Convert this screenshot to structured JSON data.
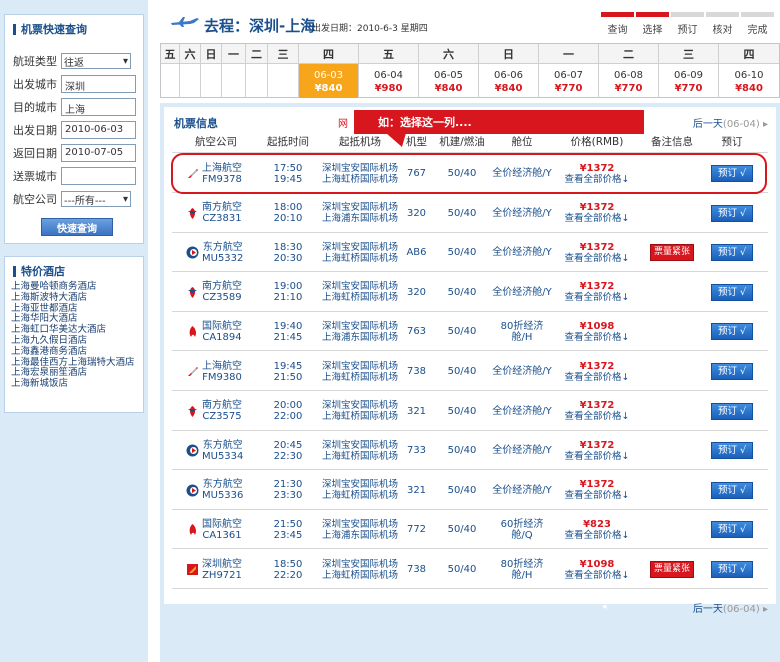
{
  "sidebar": {
    "search": {
      "title": "机票快速查询",
      "trip_type_label": "航班类型",
      "trip_type_value": "往返",
      "from_label": "出发城市",
      "from_value": "深圳",
      "to_label": "目的城市",
      "to_value": "上海",
      "depart_label": "出发日期",
      "depart_value": "2010-06-03",
      "return_label": "返回日期",
      "return_value": "2010-07-05",
      "delivery_label": "送票城市",
      "delivery_value": "",
      "airline_label": "航空公司",
      "airline_value": "---所有---",
      "submit_label": "快速查询"
    },
    "hotels": {
      "title": "特价酒店",
      "items": [
        "上海曼哈顿商务酒店",
        "上海斯波特大酒店",
        "上海亚世都酒店",
        "上海华阳大酒店",
        "上海虹口华美达大酒店",
        "上海九久假日酒店",
        "上海鑫港商务酒店",
        "上海最佳西方上海瑞特大酒店",
        "上海宏泉丽笙酒店",
        "上海新城饭店"
      ]
    }
  },
  "header": {
    "route": "去程：深圳-上海",
    "date_info": "出发日期：2010-6-3 星期四",
    "steps": [
      {
        "label": "查询",
        "active": true
      },
      {
        "label": "选择",
        "active": true
      },
      {
        "label": "预订",
        "active": false
      },
      {
        "label": "核对",
        "active": false
      },
      {
        "label": "完成",
        "active": false
      }
    ]
  },
  "calendar": {
    "weekdays": [
      "五",
      "六",
      "日",
      "一",
      "二",
      "三",
      "四",
      "五",
      "六",
      "日",
      "一",
      "二",
      "三",
      "四"
    ],
    "days": [
      {
        "date": "06-03",
        "price": "¥840",
        "selected": true
      },
      {
        "date": "06-04",
        "price": "¥980",
        "selected": false
      },
      {
        "date": "06-05",
        "price": "¥840",
        "selected": false
      },
      {
        "date": "06-06",
        "price": "¥840",
        "selected": false
      },
      {
        "date": "06-07",
        "price": "¥770",
        "selected": false
      },
      {
        "date": "06-08",
        "price": "¥770",
        "selected": false
      },
      {
        "date": "06-09",
        "price": "¥770",
        "selected": false
      },
      {
        "date": "06-10",
        "price": "¥840",
        "selected": false
      }
    ]
  },
  "panel": {
    "title": "机票信息",
    "callout_prefix": "网",
    "callout": "如：选择这一列....",
    "next_day_label": "后一天",
    "next_day_date": "(06-04)",
    "columns": [
      "航空公司",
      "起抵时间",
      "起抵机场",
      "机型",
      "机建/燃油",
      "舱位",
      "价格(RMB)",
      "备注信息",
      "预订"
    ]
  },
  "flights": [
    {
      "airline": "上海航空",
      "code": "FM9378",
      "dep": "17:50",
      "arr": "19:45",
      "from_airport": "深圳宝安国际机场",
      "to_airport": "上海虹桥国际机场",
      "model": "767",
      "tax": "50/40",
      "cabin": "全价经济舱/Y",
      "price": "¥1372",
      "note": "",
      "logo": "sha"
    },
    {
      "airline": "南方航空",
      "code": "CZ3831",
      "dep": "18:00",
      "arr": "20:10",
      "from_airport": "深圳宝安国际机场",
      "to_airport": "上海浦东国际机场",
      "model": "320",
      "tax": "50/40",
      "cabin": "全价经济舱/Y",
      "price": "¥1372",
      "note": "",
      "logo": "csn"
    },
    {
      "airline": "东方航空",
      "code": "MU5332",
      "dep": "18:30",
      "arr": "20:30",
      "from_airport": "深圳宝安国际机场",
      "to_airport": "上海虹桥国际机场",
      "model": "AB6",
      "tax": "50/40",
      "cabin": "全价经济舱/Y",
      "price": "¥1372",
      "note": "票量紧张",
      "logo": "ces"
    },
    {
      "airline": "南方航空",
      "code": "CZ3589",
      "dep": "19:00",
      "arr": "21:10",
      "from_airport": "深圳宝安国际机场",
      "to_airport": "上海虹桥国际机场",
      "model": "320",
      "tax": "50/40",
      "cabin": "全价经济舱/Y",
      "price": "¥1372",
      "note": "",
      "logo": "csn"
    },
    {
      "airline": "国际航空",
      "code": "CA1894",
      "dep": "19:40",
      "arr": "21:45",
      "from_airport": "深圳宝安国际机场",
      "to_airport": "上海浦东国际机场",
      "model": "763",
      "tax": "50/40",
      "cabin": "80折经济舱/H",
      "price": "¥1098",
      "note": "",
      "logo": "cca"
    },
    {
      "airline": "上海航空",
      "code": "FM9380",
      "dep": "19:45",
      "arr": "21:50",
      "from_airport": "深圳宝安国际机场",
      "to_airport": "上海虹桥国际机场",
      "model": "738",
      "tax": "50/40",
      "cabin": "全价经济舱/Y",
      "price": "¥1372",
      "note": "",
      "logo": "sha"
    },
    {
      "airline": "南方航空",
      "code": "CZ3575",
      "dep": "20:00",
      "arr": "22:00",
      "from_airport": "深圳宝安国际机场",
      "to_airport": "上海虹桥国际机场",
      "model": "321",
      "tax": "50/40",
      "cabin": "全价经济舱/Y",
      "price": "¥1372",
      "note": "",
      "logo": "csn"
    },
    {
      "airline": "东方航空",
      "code": "MU5334",
      "dep": "20:45",
      "arr": "22:30",
      "from_airport": "深圳宝安国际机场",
      "to_airport": "上海虹桥国际机场",
      "model": "733",
      "tax": "50/40",
      "cabin": "全价经济舱/Y",
      "price": "¥1372",
      "note": "",
      "logo": "ces"
    },
    {
      "airline": "东方航空",
      "code": "MU5336",
      "dep": "21:30",
      "arr": "23:30",
      "from_airport": "深圳宝安国际机场",
      "to_airport": "上海虹桥国际机场",
      "model": "321",
      "tax": "50/40",
      "cabin": "全价经济舱/Y",
      "price": "¥1372",
      "note": "",
      "logo": "ces"
    },
    {
      "airline": "国际航空",
      "code": "CA1361",
      "dep": "21:50",
      "arr": "23:45",
      "from_airport": "深圳宝安国际机场",
      "to_airport": "上海浦东国际机场",
      "model": "772",
      "tax": "50/40",
      "cabin": "60折经济舱/Q",
      "price": "¥823",
      "note": "",
      "logo": "cca"
    },
    {
      "airline": "深圳航空",
      "code": "ZH9721",
      "dep": "18:50",
      "arr": "22:20",
      "from_airport": "深圳宝安国际机场",
      "to_airport": "上海虹桥国际机场",
      "model": "738",
      "tax": "50/40",
      "cabin": "80折经济舱/H",
      "price": "¥1098",
      "note": "票量紧张",
      "logo": "csz"
    }
  ],
  "labels": {
    "view_all": "查看全部价格↓",
    "book": "预订 √"
  },
  "colors": {
    "accent_red": "#d7161e",
    "brand_blue": "#1a4f8c",
    "selected_day": "#f7a51a",
    "panel_bg": "#dbeaf7"
  }
}
